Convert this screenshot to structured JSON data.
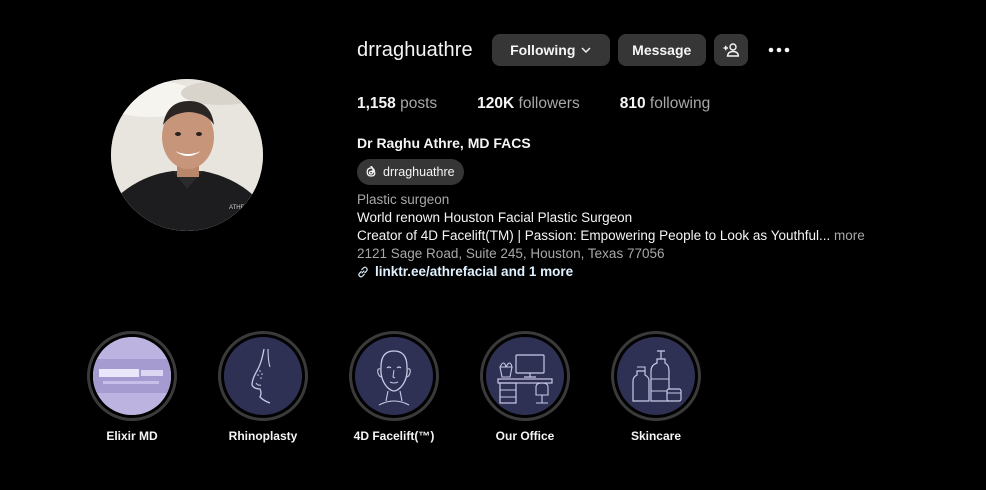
{
  "profile": {
    "username": "drraghuathre",
    "full_name": "Dr Raghu Athre, MD FACS",
    "threads_handle": "drraghuathre",
    "avatar_alt": "profile-photo"
  },
  "actions": {
    "following_label": "Following",
    "message_label": "Message"
  },
  "stats": {
    "posts_count": "1,158",
    "posts_label": "posts",
    "followers_count": "120K",
    "followers_label": "followers",
    "following_count": "810",
    "following_label": "following"
  },
  "bio": {
    "category": "Plastic surgeon",
    "line1": "World renown Houston Facial Plastic Surgeon",
    "line2": "Creator of 4D Facelift(TM) | Passion: Empowering People to Look as Youthful...",
    "more": "more",
    "address": "2121 Sage Road, Suite 245, Houston, Texas 77056",
    "link": "linktr.ee/athrefacial and 1 more"
  },
  "highlights": [
    {
      "label": "Elixir MD",
      "icon": "elixir-photo"
    },
    {
      "label": "Rhinoplasty",
      "icon": "nose-profile-icon"
    },
    {
      "label": "4D Facelift(™)",
      "icon": "face-icon"
    },
    {
      "label": "Our Office",
      "icon": "office-desk-icon"
    },
    {
      "label": "Skincare",
      "icon": "skincare-bottles-icon"
    }
  ],
  "colors": {
    "background": "#000000",
    "button": "#363636",
    "highlight_bg": "#2f3154",
    "muted_text": "#a8a8a8",
    "link_text": "#e0f1ff"
  }
}
